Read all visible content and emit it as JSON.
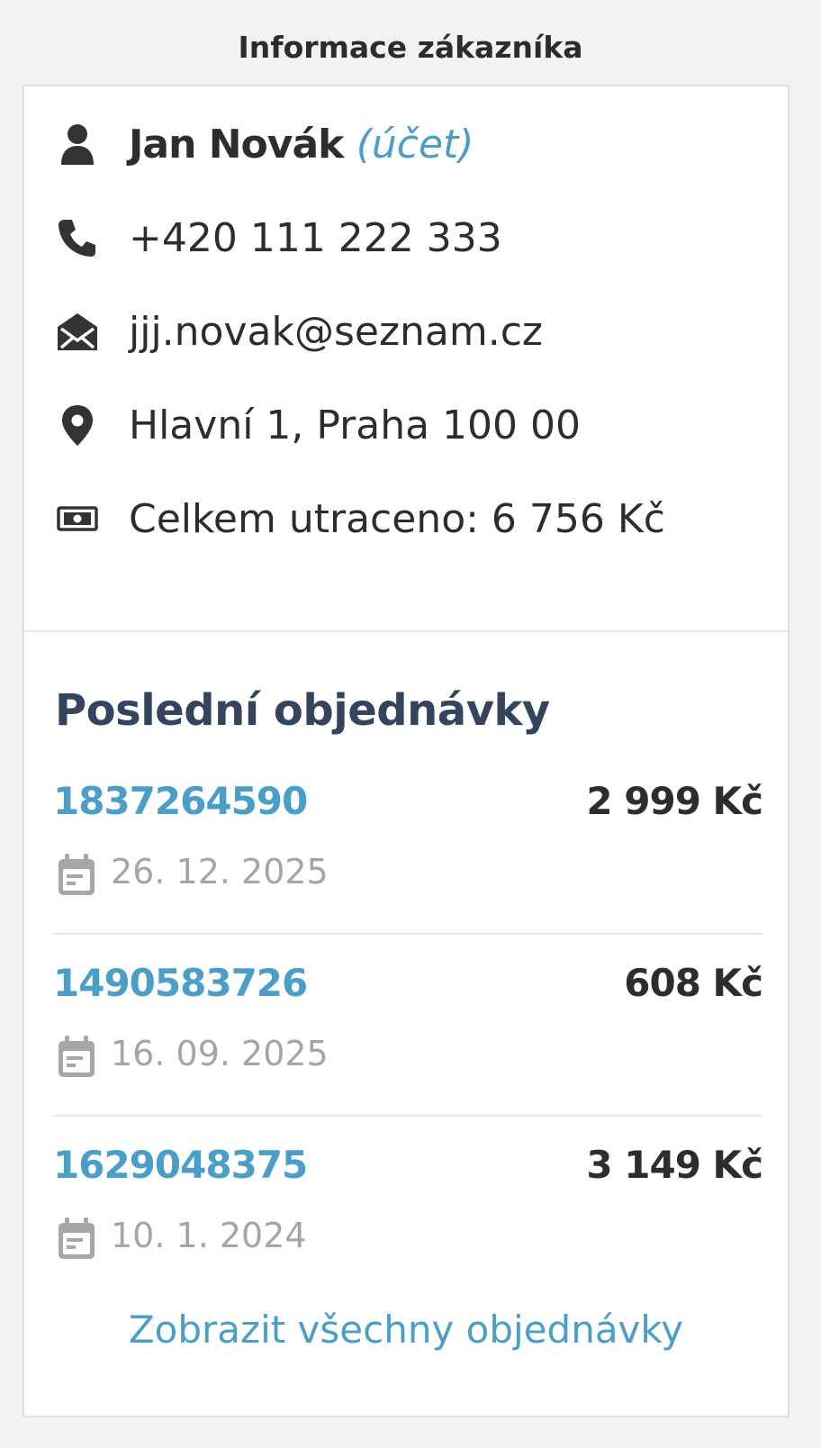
{
  "page": {
    "title": "Informace zákazníka"
  },
  "customer": {
    "name": "Jan Novák",
    "account_link": "(účet)",
    "phone": "+420 111 222 333",
    "email": "jjj.novak@seznam.cz",
    "address": "Hlavní 1, Praha 100 00",
    "total_spent": "Celkem utraceno: 6 756 Kč"
  },
  "orders": {
    "title": "Poslední objednávky",
    "items": [
      {
        "id": "1837264590",
        "price": "2 999 Kč",
        "date": "26. 12. 2025"
      },
      {
        "id": "1490583726",
        "price": "608 Kč",
        "date": "16. 09. 2025"
      },
      {
        "id": "1629048375",
        "price": "3 149 Kč",
        "date": "10. 1. 2024"
      }
    ],
    "show_all_label": "Zobrazit všechny objednávky"
  },
  "colors": {
    "accent": "#4a9ec8",
    "heading": "#33445c",
    "text": "#2d2d2d",
    "muted": "#a5a5a5",
    "background": "#f0f2f4"
  },
  "icons": {
    "name": "person-icon",
    "phone": "phone-icon",
    "email": "envelope-open-icon",
    "address": "map-pin-icon",
    "total_spent": "money-bill-icon",
    "order_date": "calendar-icon"
  }
}
